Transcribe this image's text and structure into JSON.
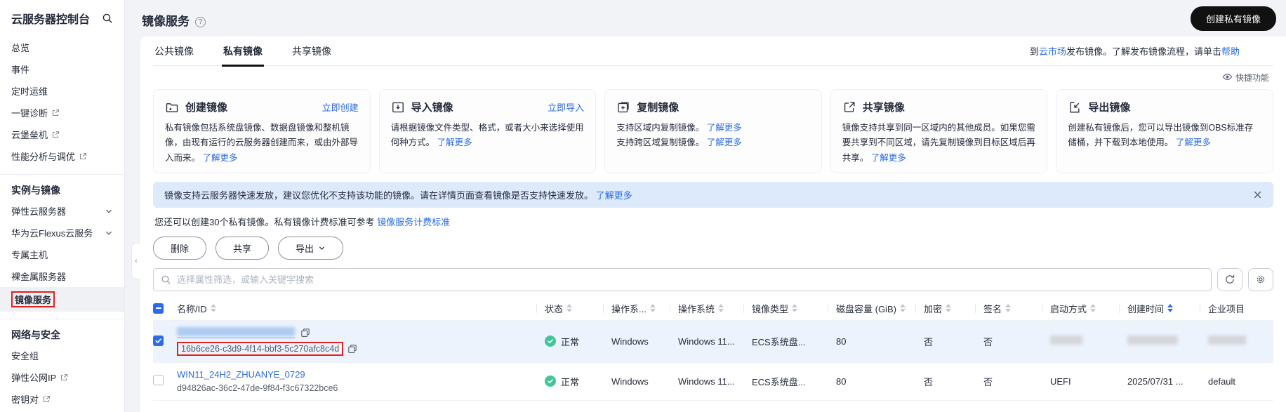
{
  "sidebar": {
    "title": "云服务器控制台",
    "groups": [
      {
        "items": [
          {
            "label": "总览"
          },
          {
            "label": "事件"
          },
          {
            "label": "定时运维"
          },
          {
            "label": "一键诊断",
            "external": true
          },
          {
            "label": "云堡垒机",
            "external": true
          },
          {
            "label": "性能分析与调优",
            "external": true
          }
        ]
      },
      {
        "header": "实例与镜像",
        "items": [
          {
            "label": "弹性云服务器",
            "expandable": true
          },
          {
            "label": "华为云Flexus云服务",
            "expandable": true
          },
          {
            "label": "专属主机"
          },
          {
            "label": "裸金属服务器"
          },
          {
            "label": "镜像服务",
            "active": true
          }
        ]
      },
      {
        "header": "网络与安全",
        "items": [
          {
            "label": "安全组"
          },
          {
            "label": "弹性公网IP",
            "external": true
          },
          {
            "label": "密钥对",
            "external": true
          }
        ]
      }
    ]
  },
  "header": {
    "title": "镜像服务",
    "create_button": "创建私有镜像"
  },
  "tabs": [
    {
      "label": "公共镜像"
    },
    {
      "label": "私有镜像",
      "active": true
    },
    {
      "label": "共享镜像"
    }
  ],
  "market_note": {
    "pre": "到",
    "marketplace_link": "云市场",
    "mid": "发布镜像。了解发布镜像流程，请单击",
    "help_link": "帮助"
  },
  "quick_features_label": "快捷功能",
  "cards": [
    {
      "title": "创建镜像",
      "icon": "create-image-icon",
      "action_link": "立即创建",
      "desc": "私有镜像包括系统盘镜像、数据盘镜像和整机镜像，由现有运行的云服务器创建而来，或由外部导入而来。",
      "more_link": "了解更多"
    },
    {
      "title": "导入镜像",
      "icon": "import-image-icon",
      "action_link": "立即导入",
      "desc": "请根据镜像文件类型、格式，或者大小来选择使用何种方式。",
      "more_link": "了解更多"
    },
    {
      "title": "复制镜像",
      "icon": "copy-image-icon",
      "lines": [
        {
          "text": "支持区域内复制镜像。",
          "more_link": "了解更多"
        },
        {
          "text": "支持跨区域复制镜像。",
          "more_link": "了解更多"
        }
      ]
    },
    {
      "title": "共享镜像",
      "icon": "share-image-icon",
      "desc": "镜像支持共享到同一区域内的其他成员。如果您需要共享到不同区域，请先复制镜像到目标区域后再共享。",
      "more_link": "了解更多"
    },
    {
      "title": "导出镜像",
      "icon": "export-image-icon",
      "desc": "创建私有镜像后，您可以导出镜像到OBS标准存储桶，并下载到本地使用。",
      "more_link": "了解更多"
    }
  ],
  "banner": {
    "text": "镜像支持云服务器快速发放，建议您优化不支持该功能的镜像。请在详情页面查看镜像是否支持快速发放。",
    "link": "了解更多"
  },
  "quota": {
    "text": "您还可以创建30个私有镜像。私有镜像计费标准可参考 ",
    "link": "镜像服务计费标准"
  },
  "toolbar": {
    "delete": "删除",
    "share": "共享",
    "export": "导出"
  },
  "search": {
    "placeholder": "选择属性筛选，或输入关键字搜索"
  },
  "table": {
    "columns": [
      {
        "label": "名称/ID"
      },
      {
        "label": "状态"
      },
      {
        "label": "操作系..."
      },
      {
        "label": "操作系统"
      },
      {
        "label": "镜像类型"
      },
      {
        "label": "磁盘容量 (GiB)"
      },
      {
        "label": "加密"
      },
      {
        "label": "签名"
      },
      {
        "label": "启动方式"
      },
      {
        "label": "创建时间",
        "sorted": true
      },
      {
        "label": "企业项目"
      }
    ],
    "rows": [
      {
        "selected": true,
        "name_redacted": true,
        "id": "16b6ce26-c3d9-4f14-bbf3-5c270afc8c4d",
        "status": "正常",
        "os_platform": "Windows",
        "os_version": "Windows 11...",
        "image_type": "ECS系统盘...",
        "disk_gib": "80",
        "encrypted": "否",
        "signed": "否"
      },
      {
        "selected": false,
        "name": "WIN11_24H2_ZHUANYE_0729",
        "id": "d94826ac-36c2-47de-9f84-f3c67322bce6",
        "status": "正常",
        "os_platform": "Windows",
        "os_version": "Windows 11...",
        "image_type": "ECS系统盘...",
        "disk_gib": "80",
        "encrypted": "否",
        "signed": "否",
        "boot_mode": "UEFI",
        "created": "2025/07/31 ...",
        "project": "default"
      }
    ]
  },
  "colors": {
    "accent_blue": "#2b6ce6",
    "status_green": "#44c49a",
    "annotation_red": "#e02121",
    "banner_bg": "#dceafc",
    "selected_row_bg": "#ecf3fd"
  }
}
